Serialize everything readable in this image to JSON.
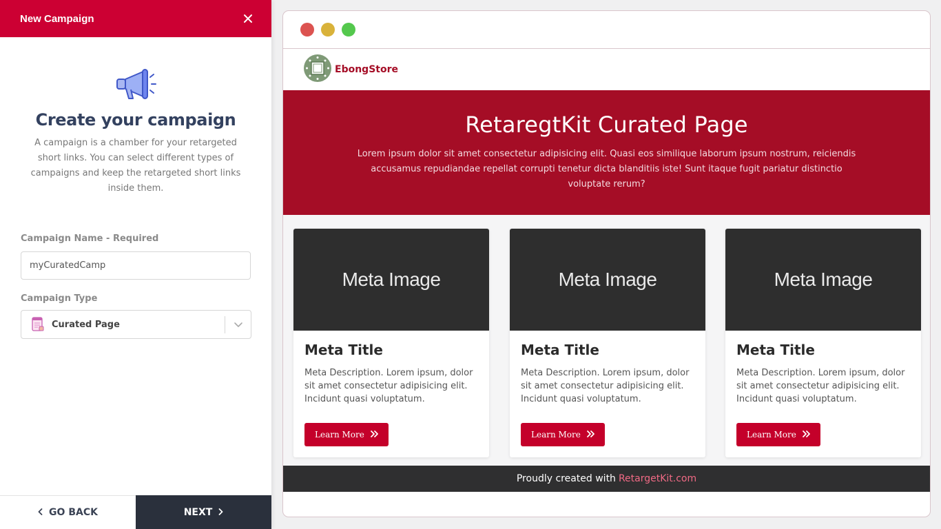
{
  "panel": {
    "title": "New Campaign",
    "close_icon": "close-icon",
    "hero_icon": "megaphone-icon",
    "heading": "Create your campaign",
    "description": "A campaign is a chamber for your retargeted short links. You can select different types of campaigns and keep the retargeted short links inside them.",
    "name_label": "Campaign Name - Required",
    "name_value": "myCuratedCamp",
    "type_label": "Campaign Type",
    "type_value": "Curated Page",
    "type_icon": "curated-page-icon",
    "back_label": "GO BACK",
    "next_label": "NEXT"
  },
  "preview": {
    "brand": "EbongStore",
    "banner_title": "RetaregtKit Curated Page",
    "banner_text": "Lorem ipsum dolor sit amet consectetur adipisicing elit. Quasi eos similique laborum ipsum nostrum, reiciendis accusamus repudiandae repellat corrupti tenetur dicta blanditiis iste! Sunt itaque fugit pariatur distinctio voluptate rerum?",
    "cards": [
      {
        "image": "Meta Image",
        "title": "Meta Title",
        "desc": "Meta Description. Lorem ipsum, dolor sit amet consectetur adipisicing elit. Incidunt quasi voluptatum.",
        "button": "Learn More"
      },
      {
        "image": "Meta Image",
        "title": "Meta Title",
        "desc": "Meta Description. Lorem ipsum, dolor sit amet consectetur adipisicing elit. Incidunt quasi voluptatum.",
        "button": "Learn More"
      },
      {
        "image": "Meta Image",
        "title": "Meta Title",
        "desc": "Meta Description. Lorem ipsum, dolor sit amet consectetur adipisicing elit. Incidunt quasi voluptatum.",
        "button": "Learn More"
      }
    ],
    "footer_text": "Proudly created with",
    "footer_link": "RetargetKit.com"
  },
  "colors": {
    "accent": "#cc0033",
    "banner": "#a50d26",
    "dot_red": "#dc5350",
    "dot_yellow": "#d9b23a",
    "dot_green": "#54c84d",
    "next_bg": "#2a303c"
  }
}
